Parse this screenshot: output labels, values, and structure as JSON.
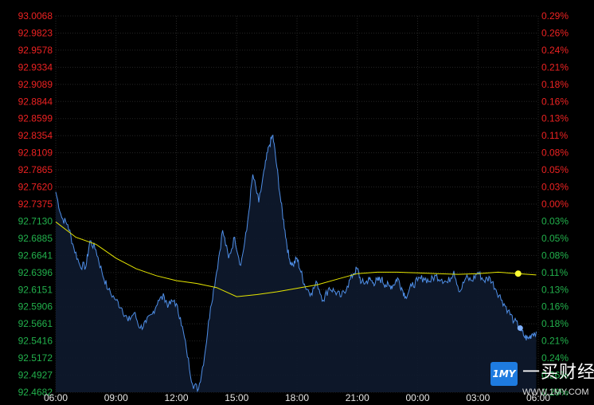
{
  "chart_data": {
    "type": "line",
    "title": "",
    "xlabel": "",
    "ylabel": "",
    "x_ticks": [
      "06:00",
      "09:00",
      "12:00",
      "15:00",
      "18:00",
      "21:00",
      "00:00",
      "03:00",
      "06:00"
    ],
    "y_left_ticks": [
      "93.0068",
      "92.9823",
      "92.9578",
      "92.9334",
      "92.9089",
      "92.8844",
      "92.8599",
      "92.8354",
      "92.8109",
      "92.7865",
      "92.7620",
      "92.7375",
      "92.7130",
      "92.6885",
      "92.6641",
      "92.6396",
      "92.6151",
      "92.5906",
      "92.5661",
      "92.5416",
      "92.5172",
      "92.4927",
      "92.4682"
    ],
    "y_right_ticks": [
      "0.29%",
      "0.26%",
      "0.24%",
      "0.21%",
      "0.18%",
      "0.16%",
      "0.13%",
      "0.11%",
      "0.08%",
      "0.05%",
      "0.03%",
      "0.00%",
      "0.03%",
      "0.05%",
      "0.08%",
      "0.11%",
      "0.13%",
      "0.16%",
      "0.18%",
      "0.21%",
      "0.24%",
      "0.26%",
      "0.29%"
    ],
    "y_reference": 92.7375,
    "ylim": [
      92.4682,
      93.0068
    ],
    "xlim_hours": [
      0,
      24
    ],
    "grid": true,
    "colors": {
      "price_line": "#4f8fe8",
      "price_fill": "#0e1a2e",
      "average_line": "#e6e600",
      "up_labels": "#ee2222",
      "down_labels": "#22b14c",
      "grid": "#262626",
      "background": "#000000"
    },
    "series": [
      {
        "kind": "price",
        "x_hours": [
          0,
          0.3,
          0.6,
          0.9,
          1.2,
          1.5,
          1.7,
          2.0,
          2.3,
          2.6,
          3.0,
          3.3,
          3.6,
          3.9,
          4.2,
          4.5,
          4.8,
          5.1,
          5.4,
          5.6,
          5.9,
          6.2,
          6.5,
          6.8,
          7.1,
          7.4,
          7.7,
          8.0,
          8.3,
          8.6,
          8.9,
          9.2,
          9.5,
          9.8,
          10.1,
          10.4,
          10.6,
          10.8,
          11.0,
          11.2,
          11.4,
          11.6,
          11.8,
          12.0,
          12.2,
          12.4,
          12.7,
          13.0,
          13.3,
          13.6,
          13.9,
          14.2,
          14.5,
          14.8,
          15.0,
          15.2,
          15.4,
          15.6,
          15.8,
          16.0,
          16.2,
          16.4,
          16.6,
          16.8,
          17.0,
          17.2,
          17.4,
          17.7,
          18.0,
          18.3,
          18.6,
          18.9,
          19.2,
          19.5,
          19.8,
          20.1,
          20.4,
          20.7,
          21.0,
          21.3,
          21.6,
          21.9,
          22.2,
          22.5,
          22.8,
          23.1,
          23.3,
          23.5,
          23.7,
          23.9
        ],
        "y": [
          92.755,
          92.718,
          92.708,
          92.675,
          92.65,
          92.648,
          92.685,
          92.672,
          92.64,
          92.615,
          92.6,
          92.588,
          92.57,
          92.582,
          92.56,
          92.568,
          92.58,
          92.6,
          92.605,
          92.592,
          92.6,
          92.575,
          92.53,
          92.48,
          92.473,
          92.52,
          92.59,
          92.64,
          92.7,
          92.66,
          92.69,
          92.65,
          92.7,
          92.78,
          92.74,
          92.79,
          92.82,
          92.836,
          92.79,
          92.74,
          92.7,
          92.66,
          92.65,
          92.66,
          92.64,
          92.62,
          92.61,
          92.625,
          92.6,
          92.618,
          92.612,
          92.605,
          92.62,
          92.638,
          92.645,
          92.625,
          92.625,
          92.63,
          92.625,
          92.628,
          92.63,
          92.622,
          92.62,
          92.622,
          92.632,
          92.618,
          92.605,
          92.62,
          92.628,
          92.632,
          92.627,
          92.635,
          92.63,
          92.625,
          92.642,
          92.612,
          92.632,
          92.628,
          92.64,
          92.628,
          92.632,
          92.615,
          92.6,
          92.585,
          92.57,
          92.56,
          92.548,
          92.545,
          92.552,
          92.555
        ]
      },
      {
        "kind": "average",
        "x_hours": [
          0,
          1,
          2,
          3,
          4,
          5,
          6,
          7,
          8,
          9,
          10,
          11,
          12,
          13,
          14,
          15,
          16,
          17,
          18,
          19,
          20,
          21,
          22,
          23,
          23.9
        ],
        "y": [
          92.712,
          92.69,
          92.68,
          92.66,
          92.645,
          92.635,
          92.628,
          92.624,
          92.618,
          92.605,
          92.608,
          92.612,
          92.617,
          92.622,
          92.63,
          92.638,
          92.64,
          92.64,
          92.639,
          92.638,
          92.637,
          92.638,
          92.64,
          92.638,
          92.636
        ]
      }
    ]
  },
  "watermark": {
    "logo_text": "1MY",
    "name": "一买财经",
    "url": "WWW.1MY.COM"
  }
}
